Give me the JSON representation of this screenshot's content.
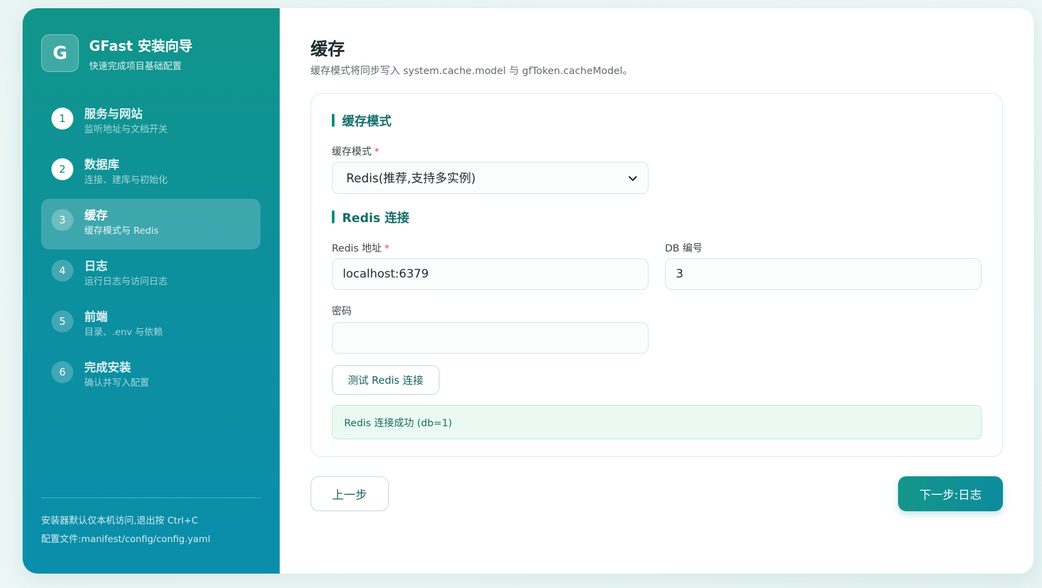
{
  "brand": {
    "logo": "G",
    "title": "GFast 安装向导",
    "subtitle": "快速完成项目基础配置"
  },
  "steps": [
    {
      "num": "1",
      "title": "服务与网站",
      "sub": "监听地址与文档开关",
      "state": "done"
    },
    {
      "num": "2",
      "title": "数据库",
      "sub": "连接、建库与初始化",
      "state": "done"
    },
    {
      "num": "3",
      "title": "缓存",
      "sub": "缓存模式与 Redis",
      "state": "active"
    },
    {
      "num": "4",
      "title": "日志",
      "sub": "运行日志与访问日志",
      "state": "todo"
    },
    {
      "num": "5",
      "title": "前端",
      "sub": "目录、.env 与依赖",
      "state": "todo"
    },
    {
      "num": "6",
      "title": "完成安装",
      "sub": "确认并写入配置",
      "state": "todo"
    }
  ],
  "sidebar_footer": {
    "line1": "安装器默认仅本机访问,退出按 Ctrl+C",
    "line2": "配置文件:manifest/config/config.yaml"
  },
  "page": {
    "title": "缓存",
    "subtitle": "缓存模式将同步写入 system.cache.model 与 gfToken.cacheModel。"
  },
  "cache_section": {
    "title": "缓存模式",
    "mode_label": "缓存模式",
    "required_mark": "*",
    "mode_value": "Redis(推荐,支持多实例)"
  },
  "redis_section": {
    "title": "Redis 连接",
    "address_label": "Redis 地址",
    "address_value": "localhost:6379",
    "db_label": "DB 编号",
    "db_value": "3",
    "password_label": "密码",
    "password_value": "",
    "test_button": "测试 Redis 连接",
    "status_message": "Redis 连接成功 (db=1)"
  },
  "nav": {
    "prev_label": "上一步",
    "next_label": "下一步:日志"
  },
  "icons": {
    "select": "chevron-down-icon"
  },
  "colors": {
    "accent": "#11958a",
    "accent_dark": "#0a8eab",
    "success_bg": "#eafaf2",
    "required": "#e0485a"
  }
}
